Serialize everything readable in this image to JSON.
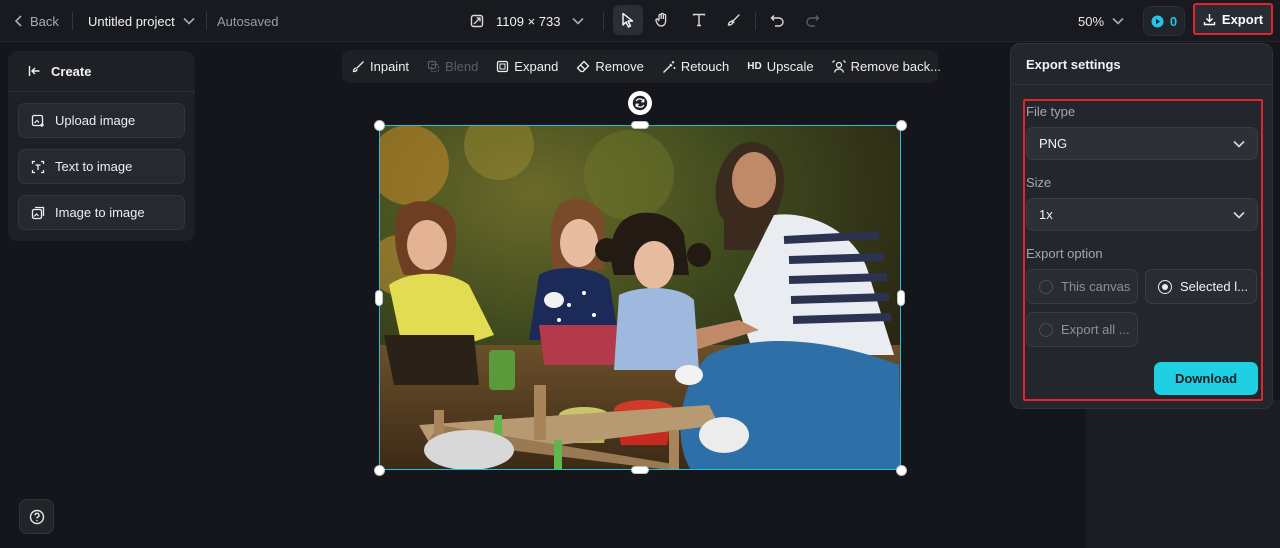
{
  "topbar": {
    "back_label": "Back",
    "project_name": "Untitled project",
    "autosave_status": "Autosaved",
    "canvas_size": "1109 × 733",
    "zoom": "50%",
    "credits": "0",
    "export_label": "Export"
  },
  "create_panel": {
    "title": "Create",
    "items": [
      {
        "label": "Upload image"
      },
      {
        "label": "Text to image"
      },
      {
        "label": "Image to image"
      }
    ]
  },
  "edit_toolbar": {
    "items": [
      {
        "label": "Inpaint",
        "icon": "inpaint-icon",
        "enabled": true
      },
      {
        "label": "Blend",
        "icon": "blend-icon",
        "enabled": false
      },
      {
        "label": "Expand",
        "icon": "expand-icon",
        "enabled": true
      },
      {
        "label": "Remove",
        "icon": "eraser-icon",
        "enabled": true
      },
      {
        "label": "Retouch",
        "icon": "magic-wand-icon",
        "enabled": true
      },
      {
        "label": "Upscale",
        "icon": "hd-icon",
        "enabled": true
      },
      {
        "label": "Remove back...",
        "icon": "remove-background-icon",
        "enabled": true
      }
    ]
  },
  "export_settings": {
    "title": "Export settings",
    "file_type_label": "File type",
    "file_type_value": "PNG",
    "size_label": "Size",
    "size_value": "1x",
    "export_option_label": "Export option",
    "options": [
      {
        "label": "This canvas",
        "selected": false
      },
      {
        "label": "Selected l...",
        "selected": true
      },
      {
        "label": "Export all ...",
        "selected": false
      }
    ],
    "download_label": "Download"
  },
  "colors": {
    "accent": "#1ed0e2",
    "highlight": "#e0262d",
    "selection": "#1fc3d3",
    "background": "#15161b"
  }
}
